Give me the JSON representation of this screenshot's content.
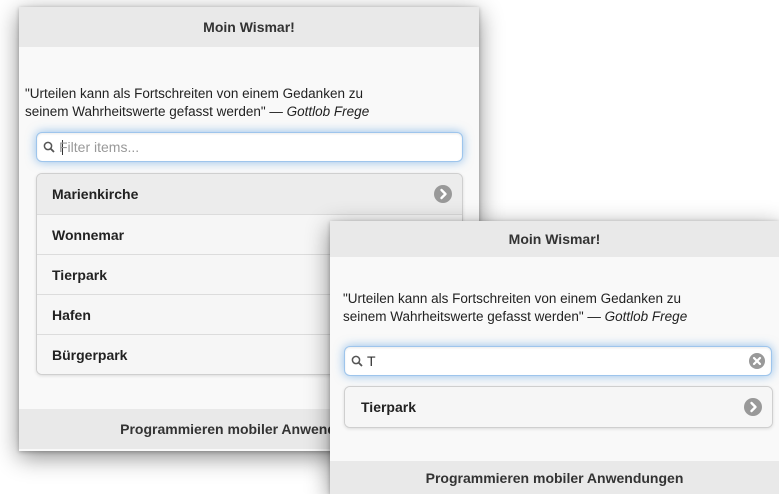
{
  "screens": [
    {
      "header": "Moin Wismar!",
      "quote": {
        "line1": "\"Urteilen kann als Fortschreiten von einem Gedanken zu",
        "line2": "seinem Wahrheitswerte gefasst werden\" — ",
        "author": "Gottlob Frege"
      },
      "search": {
        "placeholder": "Filter items...",
        "value": ""
      },
      "items": [
        "Marienkirche",
        "Wonnemar",
        "Tierpark",
        "Hafen",
        "Bürgerpark"
      ],
      "footer": "Programmieren mobiler Anwendungen"
    },
    {
      "header": "Moin Wismar!",
      "quote": {
        "line1": "\"Urteilen kann als Fortschreiten von einem Gedanken zu",
        "line2": "seinem Wahrheitswerte gefasst werden\" — ",
        "author": "Gottlob Frege"
      },
      "search": {
        "placeholder": "Filter items...",
        "value": "T"
      },
      "items": [
        "Tierpark"
      ],
      "footer": "Programmieren mobiler Anwendungen"
    }
  ],
  "icons": {
    "search": "search-icon",
    "chevron": "chevron-right-icon",
    "clear": "clear-icon"
  },
  "colors": {
    "header_bg": "#e9e9e9",
    "focus_glow": "#388cdc",
    "chevron": "#999999"
  }
}
